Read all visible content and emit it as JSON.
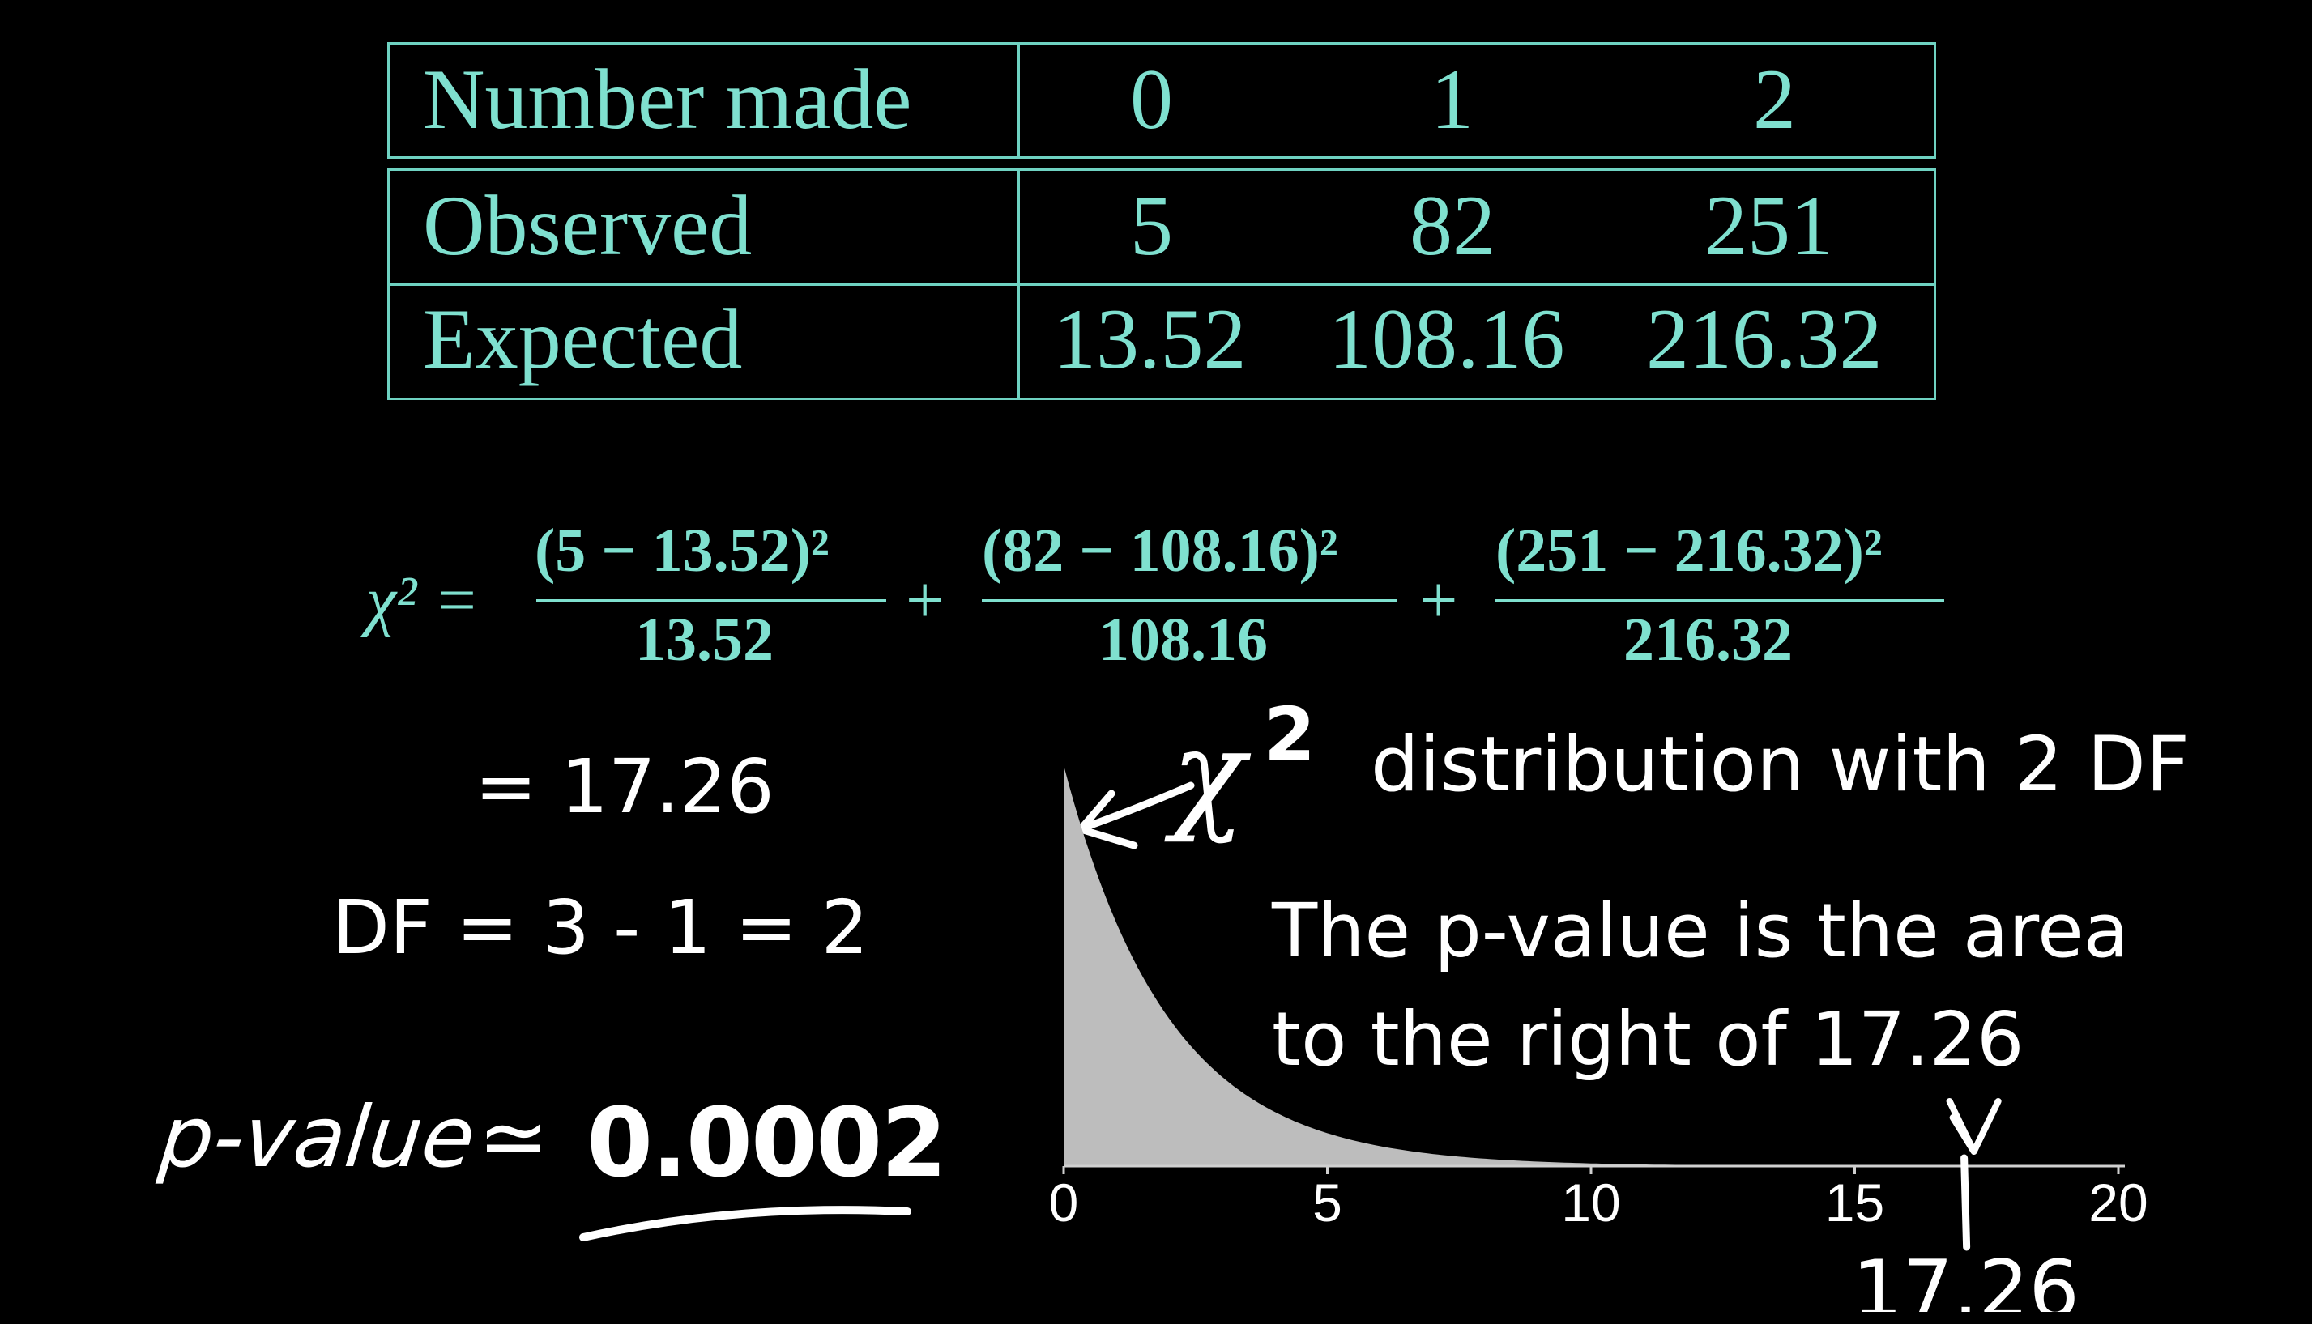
{
  "table": {
    "headers": [
      "Number made",
      "0",
      "1",
      "2"
    ],
    "rows": [
      {
        "label": "Observed",
        "values": [
          "5",
          "82",
          "251"
        ]
      },
      {
        "label": "Expected",
        "values": [
          "13.52",
          "108.16",
          "216.32"
        ]
      }
    ]
  },
  "formula": {
    "lhs": "χ² =",
    "terms": [
      {
        "numerator": "(5 − 13.52)²",
        "denominator": "13.52"
      },
      {
        "numerator": "(82 − 108.16)²",
        "denominator": "108.16"
      },
      {
        "numerator": "(251 − 216.32)²",
        "denominator": "216.32"
      }
    ],
    "plus": "+"
  },
  "result": "= 17.26",
  "df": "DF = 3 - 1 = 2",
  "pvalue": {
    "label": "p-value",
    "approx": "≃",
    "value": "0.0002"
  },
  "dist_label": {
    "symbol": "χ",
    "power": "2",
    "text": "distribution with 2 DF"
  },
  "explanation": [
    "The p-value is the area",
    "to the right of 17.26"
  ],
  "chart_data": {
    "type": "area",
    "x_ticks": [
      "0",
      "5",
      "10",
      "15",
      "20"
    ],
    "xlim": [
      0,
      20
    ],
    "marker": {
      "value": 17.26,
      "label": "17.26"
    },
    "fill_color": "#bdbdbd"
  }
}
